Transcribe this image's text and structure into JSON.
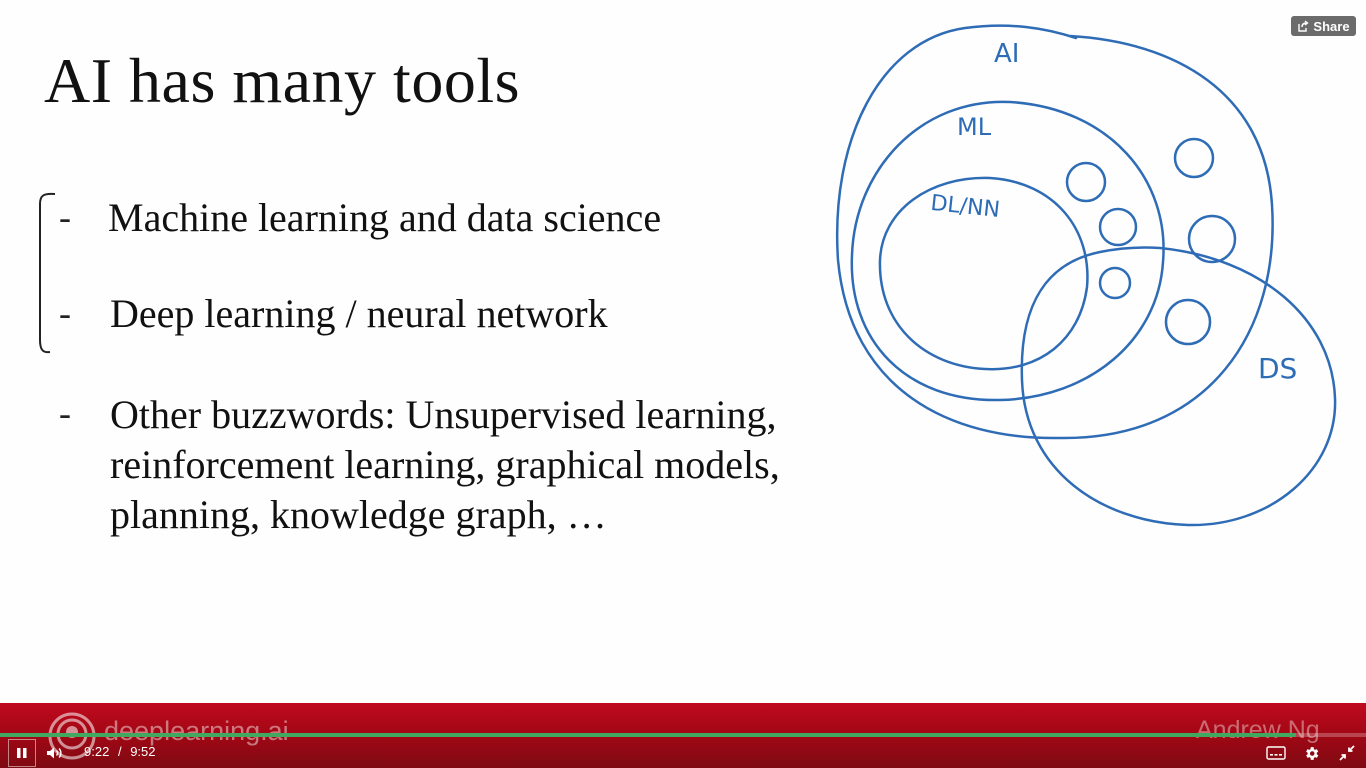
{
  "slide": {
    "title": "AI has many tools",
    "bullet_marker": "-",
    "bullets": [
      "Machine learning and data science",
      "Deep learning / neural network"
    ],
    "other_bullet": [
      "Other buzzwords: Unsupervised learning,",
      "reinforcement learning, graphical models,",
      "planning, knowledge graph, …"
    ]
  },
  "diagram": {
    "labels": {
      "ai": "AI",
      "ml": "ML",
      "dl": "DL/NN",
      "ds": "DS"
    },
    "ink_color": "#2f6cb6"
  },
  "player": {
    "share_label": "Share",
    "current_time": "9:22",
    "separator": "/",
    "duration": "9:52",
    "progress": 0.949,
    "progress_color": "#40a85f"
  },
  "banner": {
    "brand": "deeplearning.ai",
    "author": "Andrew Ng",
    "background_color": "#a30715"
  },
  "icons": [
    "share-icon",
    "pause-icon",
    "volume-icon",
    "captions-icon",
    "settings-gear-icon",
    "exit-fullscreen-icon",
    "deeplearning-logo-icon"
  ]
}
